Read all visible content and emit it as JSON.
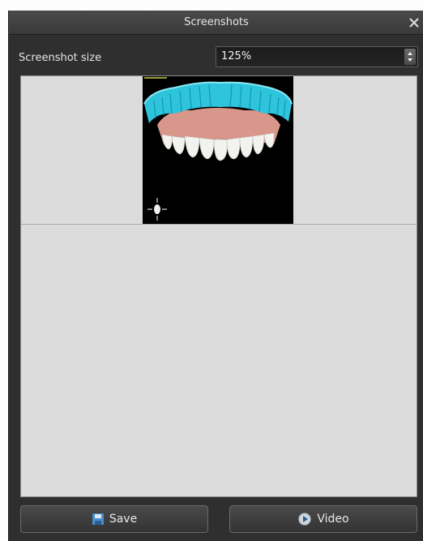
{
  "dialog": {
    "title": "Screenshots",
    "close_icon": "close-icon"
  },
  "size_setting": {
    "label": "Screenshot size",
    "value": "125%",
    "spinner_icon": "spinner-arrows-icon"
  },
  "preview": {
    "thumbnail_icon": "dental-model-thumbnail"
  },
  "buttons": {
    "save_label": "Save",
    "save_icon": "floppy-disk-icon",
    "video_label": "Video",
    "video_icon": "video-camera-icon"
  },
  "colors": {
    "dialog_bg": "#2f2f2f",
    "preview_bg": "#dcdcdc",
    "model_cyan": "#2ec4dc",
    "gum_pink": "#d9968a"
  }
}
